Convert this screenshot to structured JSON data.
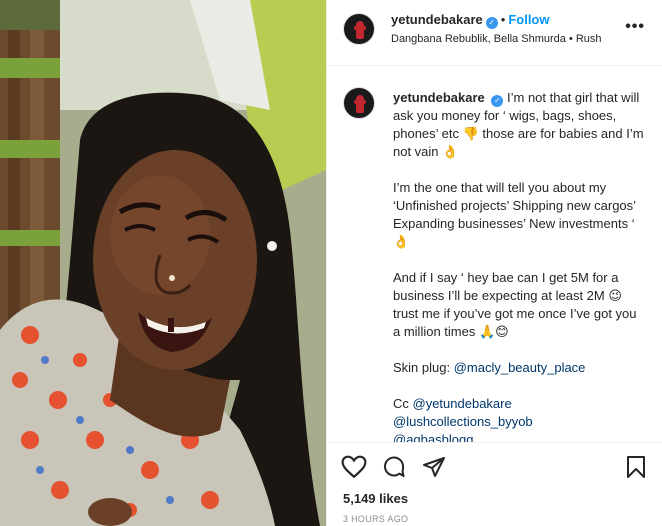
{
  "header": {
    "username": "yetundebakare",
    "follow_label": "Follow",
    "subtitle": "Dangbana Rebublik, Bella Shmurda • Rush"
  },
  "caption": {
    "username": "yetundebakare",
    "paragraph1": "I’m not that girl that will ask you money for ‘ wigs, bags, shoes, phones’ etc 👎 those are for babies and I’m not vain 👌",
    "paragraph2": "I’m the one that will tell you about my ‘Unfinished projects’ Shipping new cargos’ Expanding businesses’ New investments ‘ 👌",
    "paragraph3": "And if I say ‘ hey bae can I get 5M for a business I’ll be expecting at least 2M 😉 trust me if you’ve got me once I’ve got you a million times 🙏😊",
    "skin_plug_label": "Skin plug: ",
    "skin_plug_handle": "@macly_beauty_place",
    "cc_label": "Cc ",
    "cc_handles": [
      "@yetundebakare",
      "@lushcollections_byyob",
      "@agbasblogg"
    ]
  },
  "actions": {
    "likes": "5,149 likes",
    "time": "3 HOURS AGO"
  },
  "icons": [
    "heart-icon",
    "comment-icon",
    "share-icon",
    "bookmark-icon",
    "more-options-icon",
    "verified-icon"
  ],
  "colors": {
    "link": "#00376b",
    "follow": "#0095f6",
    "verified": "#3897f0"
  }
}
